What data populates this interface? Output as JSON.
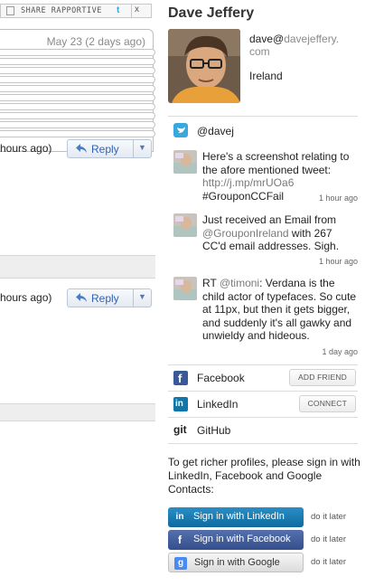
{
  "share_bar": {
    "label": "SHARE RAPPORTIVE",
    "twitter_glyph": "t",
    "close_glyph": "x"
  },
  "mail": {
    "date": "May 23 (2 days ago)",
    "messages": [
      {
        "time_text": "hours ago)",
        "reply_label": "Reply"
      },
      {
        "time_text": "hours ago)",
        "reply_label": "Reply"
      }
    ]
  },
  "profile": {
    "name": "Dave Jeffery",
    "email_user": "dave@",
    "email_domain_line1": "davejeffery.",
    "email_domain_line2": "com",
    "location": "Ireland"
  },
  "twitter": {
    "handle": "@davej",
    "tweets": [
      {
        "pre": "Here's a screenshot relating to the afore mentioned tweet: ",
        "link": "http://j.mp/mrUOa6",
        "post": " #GrouponCCFail",
        "time": "1 hour ago"
      },
      {
        "pre": "Just received an Email from ",
        "link": "@GrouponIreland",
        "post": " with 267 CC'd email addresses. Sigh.",
        "time": "1 hour ago"
      },
      {
        "pre": "RT ",
        "link": "@timoni",
        "post": ": Verdana is the child actor of typefaces. So cute at 11px, but then it gets bigger, and suddenly it's all gawky and unwieldy and hideous.",
        "time": "1 day ago"
      }
    ]
  },
  "networks": [
    {
      "label": "Facebook",
      "button": "ADD FRIEND",
      "icon": "facebook-icon"
    },
    {
      "label": "LinkedIn",
      "button": "CONNECT",
      "icon": "linkedin-icon"
    },
    {
      "label": "GitHub",
      "icon": "github-icon",
      "icon_text": "git"
    }
  ],
  "signin": {
    "prompt": "To get richer profiles, please sign in with LinkedIn, Facebook and Google Contacts:",
    "buttons": [
      {
        "label": "Sign in with LinkedIn",
        "later": "do it later",
        "glyph": "in"
      },
      {
        "label": "Sign in with Facebook",
        "later": "do it later",
        "glyph": "f"
      },
      {
        "label": "Sign in with Google",
        "later": "do it later",
        "glyph": "g"
      }
    ]
  },
  "colors": {
    "twitter": "#38a8dd",
    "facebook": "#3b5998",
    "linkedin": "#0e76a8",
    "link_gray": "#7a7a7a"
  }
}
